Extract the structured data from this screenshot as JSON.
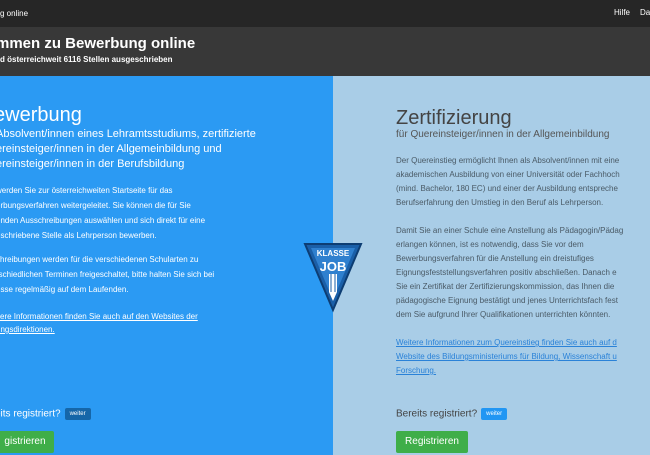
{
  "topbar": {
    "brand": "g online",
    "links": [
      "Hilfe",
      "Dat"
    ]
  },
  "hero": {
    "title": "mmen zu Bewerbung online",
    "subtitle": "d österreichweit 6116 Stellen ausgeschrieben"
  },
  "left": {
    "title": "ewerbung",
    "subtitle_lines": [
      "Absolvent/innen eines Lehramtsstudiums, zertifizierte",
      "ereinsteiger/innen in der Allgemeinbildung und",
      "ereinsteiger/innen in der Berufsbildung"
    ],
    "para1_lines": [
      "werden Sie zur österreichweiten Startseite für das",
      "erbungsverfahren weitergeleitet. Sie können die für Sie",
      "enden Ausschreibungen auswählen und sich direkt für eine",
      "eschriebene Stelle als Lehrperson bewerben."
    ],
    "para2_lines": [
      "chreibungen werden für die verschiedenen Schularten zu",
      "rschiedlichen Terminen freigeschaltet, bitte halten Sie sich bei",
      "esse regelmäßig auf dem Laufenden."
    ],
    "link_lines": [
      "itere Informationen finden Sie auch auf den Websites der",
      "ungsdirektionen."
    ],
    "registered_label": "eits registriert?",
    "weiter": "weiter",
    "register_button": "gistrieren"
  },
  "right": {
    "title": "Zertifizierung",
    "subtitle": "für Quereinsteiger/innen in der Allgemeinbildung",
    "para1_lines": [
      "Der Quereinstieg ermöglicht Ihnen als Absolvent/innen mit eine",
      "akademischen Ausbildung von einer Universität oder Fachhoch",
      "(mind. Bachelor, 180 EC) und einer der Ausbildung entspreche",
      "Berufserfahrung den Umstieg in den Beruf als Lehrperson."
    ],
    "para2_lines": [
      "Damit Sie an einer Schule eine Anstellung als Pädagogin/Pädag",
      "erlangen können, ist es notwendig, dass Sie vor dem",
      "Bewerbungsverfahren für die Anstellung ein dreistufiges",
      "Eignungsfeststellungsverfahren positiv abschließen. Danach e",
      "Sie ein Zertifikat der Zertifizierungskommission, das Ihnen die",
      "pädagogische Eignung bestätigt und jenes Unterrichtsfach fest",
      "dem Sie aufgrund Ihrer Qualifikationen unterrichten könnten."
    ],
    "link_lines": [
      "Weitere Informationen zum Quereinstieg finden Sie auch auf d",
      "Website des Bildungsministeriums für Bildung, Wissenschaft u",
      "Forschung."
    ],
    "registered_label": "Bereits registriert?",
    "weiter": "weiter",
    "register_button": "Registrieren"
  },
  "logo": {
    "line1": "KLASSE",
    "line2": "JOB"
  }
}
